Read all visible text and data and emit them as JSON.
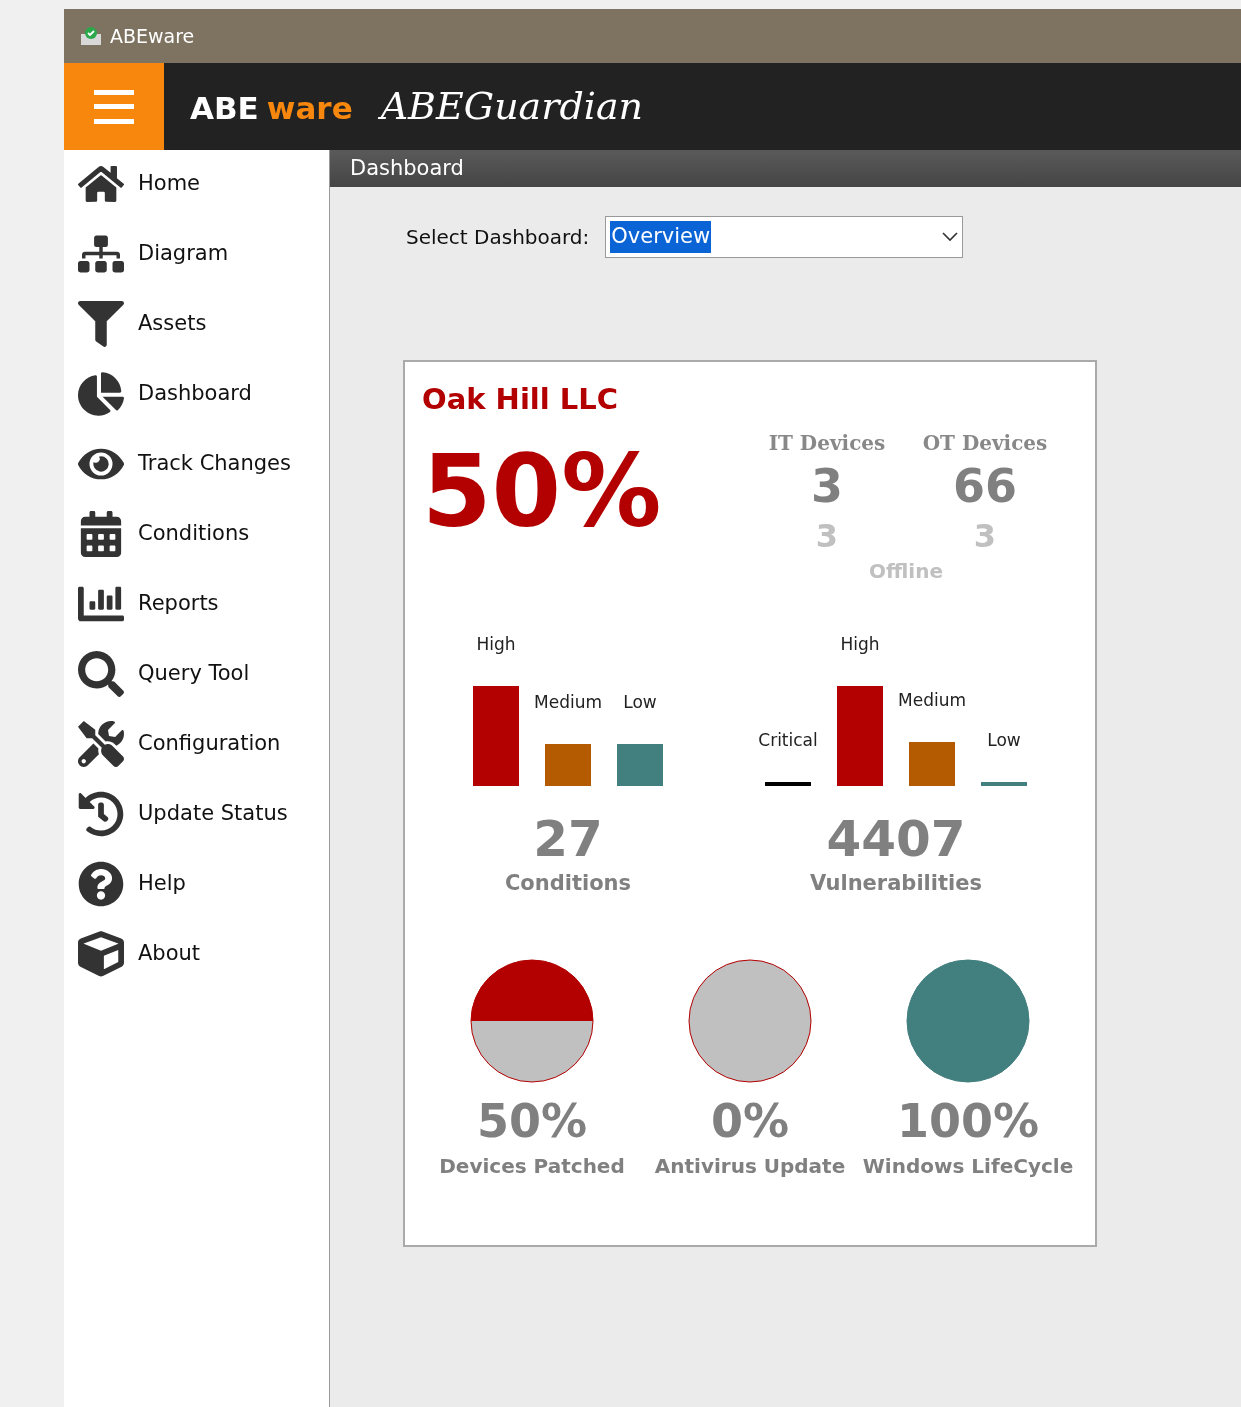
{
  "window": {
    "title": "ABEware"
  },
  "header": {
    "logo_left": "ABE",
    "logo_right": "ware",
    "product": "ABEGuardian"
  },
  "sidebar": {
    "items": [
      {
        "label": "Home",
        "selected": false
      },
      {
        "label": "Diagram",
        "selected": false
      },
      {
        "label": "Assets",
        "selected": false
      },
      {
        "label": "Dashboard",
        "selected": false
      },
      {
        "label": "Track Changes",
        "selected": false
      },
      {
        "label": "Conditions",
        "selected": false
      },
      {
        "label": "Reports",
        "selected": false
      },
      {
        "label": "Query Tool",
        "selected": false
      },
      {
        "label": "Configuration",
        "selected": false
      },
      {
        "label": "Update Status",
        "selected": false
      },
      {
        "label": "Help",
        "selected": false
      },
      {
        "label": "About",
        "selected": false
      }
    ]
  },
  "page_title": "Dashboard",
  "selector": {
    "label": "Select Dashboard:",
    "value": "Overview"
  },
  "card": {
    "company": "Oak Hill LLC",
    "score": "50%",
    "devices": [
      {
        "label": "IT Devices",
        "count": "3",
        "offline": "3"
      },
      {
        "label": "OT Devices",
        "count": "66",
        "offline": "3"
      }
    ],
    "offline_label": "Offline",
    "bar_groups": [
      {
        "total": "27",
        "label": "Conditions",
        "bars": [
          {
            "label": "High",
            "color": "#b30000"
          },
          {
            "label": "Medium",
            "color": "#b45a00"
          },
          {
            "label": "Low",
            "color": "#42807f"
          }
        ]
      },
      {
        "total": "4407",
        "label": "Vulnerabilities",
        "bars": [
          {
            "label": "Critical",
            "color": "#000000"
          },
          {
            "label": "High",
            "color": "#b30000"
          },
          {
            "label": "Medium",
            "color": "#b45a00"
          },
          {
            "label": "Low",
            "color": "#42807f"
          }
        ]
      }
    ],
    "gauges": [
      {
        "value": "50%",
        "label": "Devices Patched",
        "color": "#b30000"
      },
      {
        "value": "0%",
        "label": "Antivirus Update",
        "color": "#b30000"
      },
      {
        "value": "100%",
        "label": "Windows LifeCycle",
        "color": "#42807f"
      }
    ]
  }
}
